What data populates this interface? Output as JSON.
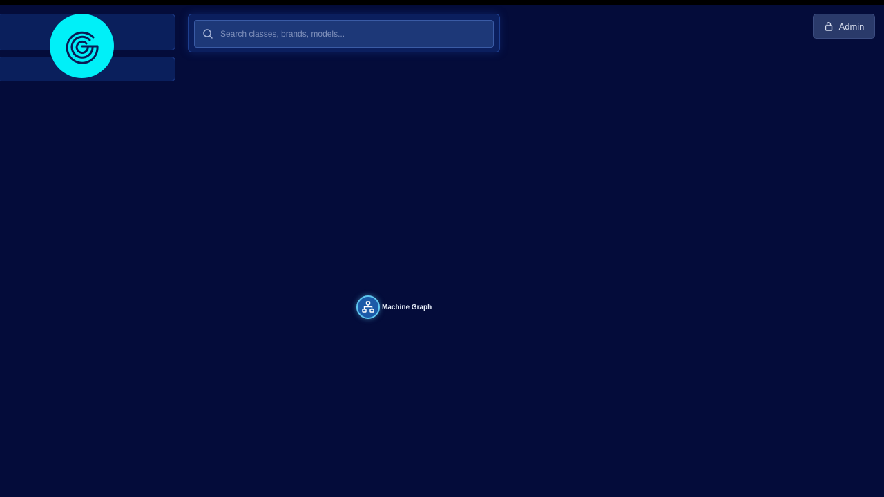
{
  "header": {
    "search": {
      "placeholder": "Search classes, brands, models...",
      "value": ""
    },
    "admin_button": {
      "label": "Admin"
    }
  },
  "graph": {
    "nodes": [
      {
        "label": "Machine Graph",
        "icon": "hierarchy-icon"
      }
    ]
  },
  "colors": {
    "background": "#040c3a",
    "accent": "#00f0f8",
    "node_border": "#5fc6ef"
  }
}
